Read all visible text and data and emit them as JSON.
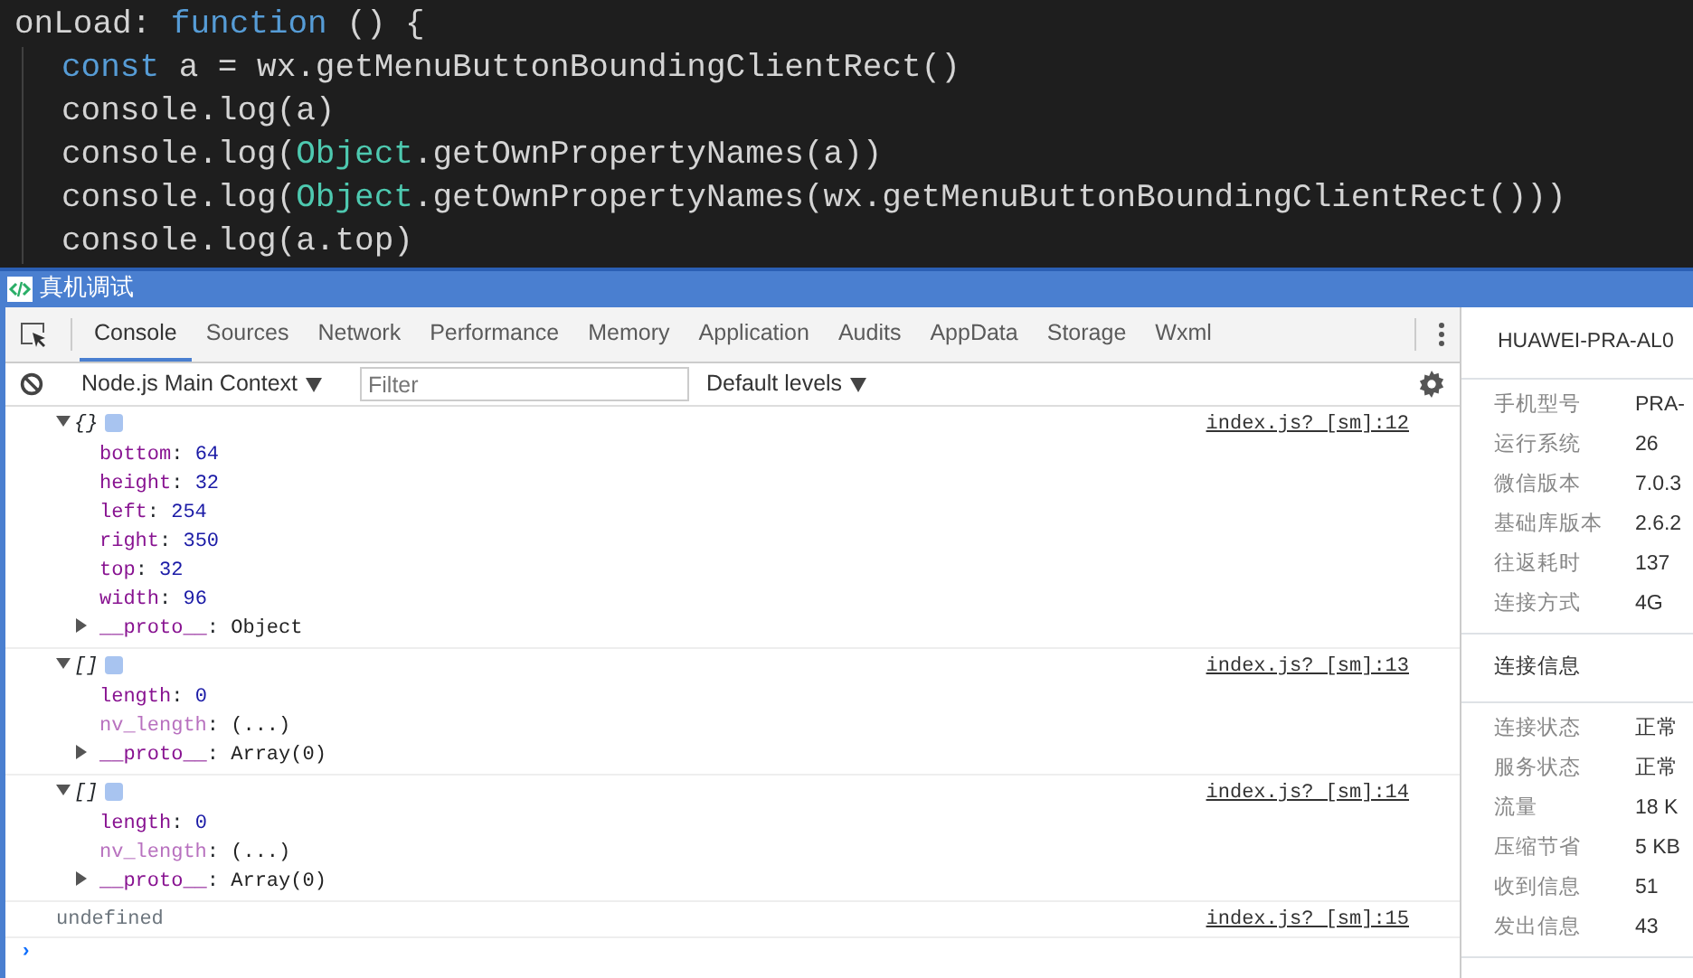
{
  "editor": {
    "lines": [
      {
        "indented": false,
        "tokens": [
          {
            "text": "onLoad: ",
            "kind": "plain"
          },
          {
            "text": "function",
            "kind": "keyword"
          },
          {
            "text": " () {",
            "kind": "plain"
          }
        ]
      },
      {
        "indented": true,
        "tokens": [
          {
            "text": "const",
            "kind": "keyword"
          },
          {
            "text": " a = wx.getMenuButtonBoundingClientRect()",
            "kind": "plain"
          }
        ]
      },
      {
        "indented": true,
        "tokens": [
          {
            "text": "console.log(a)",
            "kind": "plain"
          }
        ]
      },
      {
        "indented": true,
        "tokens": [
          {
            "text": "console.log(",
            "kind": "plain"
          },
          {
            "text": "Object",
            "kind": "builtin"
          },
          {
            "text": ".getOwnPropertyNames(a))",
            "kind": "plain"
          }
        ]
      },
      {
        "indented": true,
        "tokens": [
          {
            "text": "console.log(",
            "kind": "plain"
          },
          {
            "text": "Object",
            "kind": "builtin"
          },
          {
            "text": ".getOwnPropertyNames(wx.getMenuButtonBoundingClientRect()))",
            "kind": "plain"
          }
        ]
      },
      {
        "indented": true,
        "tokens": [
          {
            "text": "console.log(a.top)",
            "kind": "plain"
          }
        ]
      }
    ]
  },
  "window": {
    "title": "真机调试"
  },
  "tabs": [
    {
      "label": "Console",
      "selected": true
    },
    {
      "label": "Sources",
      "selected": false
    },
    {
      "label": "Network",
      "selected": false
    },
    {
      "label": "Performance",
      "selected": false
    },
    {
      "label": "Memory",
      "selected": false
    },
    {
      "label": "Application",
      "selected": false
    },
    {
      "label": "Audits",
      "selected": false
    },
    {
      "label": "AppData",
      "selected": false
    },
    {
      "label": "Storage",
      "selected": false
    },
    {
      "label": "Wxml",
      "selected": false
    }
  ],
  "toolbar": {
    "context": "Node.js Main Context",
    "filter": {
      "placeholder": "Filter"
    },
    "levels": "Default levels"
  },
  "console": {
    "entries": [
      {
        "kind": "tree",
        "summary": "{}",
        "expanded": true,
        "source": "index.js? [sm]:12",
        "properties": [
          {
            "key": "bottom",
            "value": "64",
            "kind": "number"
          },
          {
            "key": "height",
            "value": "32",
            "kind": "number"
          },
          {
            "key": "left",
            "value": "254",
            "kind": "number"
          },
          {
            "key": "right",
            "value": "350",
            "kind": "number"
          },
          {
            "key": "top",
            "value": "32",
            "kind": "number"
          },
          {
            "key": "width",
            "value": "96",
            "kind": "number"
          },
          {
            "key": "__proto__",
            "value": "Object",
            "kind": "proto"
          }
        ]
      },
      {
        "kind": "tree",
        "summary": "[]",
        "expanded": true,
        "source": "index.js? [sm]:13",
        "properties": [
          {
            "key": "length",
            "value": "0",
            "kind": "number"
          },
          {
            "key": "nv_length",
            "value": "(...)",
            "kind": "getter"
          },
          {
            "key": "__proto__",
            "value": "Array(0)",
            "kind": "proto"
          }
        ]
      },
      {
        "kind": "tree",
        "summary": "[]",
        "expanded": true,
        "source": "index.js? [sm]:14",
        "properties": [
          {
            "key": "length",
            "value": "0",
            "kind": "number"
          },
          {
            "key": "nv_length",
            "value": "(...)",
            "kind": "getter"
          },
          {
            "key": "__proto__",
            "value": "Array(0)",
            "kind": "proto"
          }
        ]
      },
      {
        "kind": "value",
        "summary": "undefined",
        "source": "index.js? [sm]:15"
      }
    ],
    "separator": ":",
    "prompt": "›"
  },
  "device_panel": {
    "device": "HUAWEI-PRA-AL0",
    "info": [
      {
        "label": "手机型号",
        "value": "PRA-"
      },
      {
        "label": "运行系统",
        "value": "26"
      },
      {
        "label": "微信版本",
        "value": "7.0.3"
      },
      {
        "label": "基础库版本",
        "value": "2.6.2"
      },
      {
        "label": "往返耗时",
        "value": "137"
      },
      {
        "label": "连接方式",
        "value": "4G"
      }
    ],
    "section": "连接信息",
    "connection": [
      {
        "label": "连接状态",
        "value": "正常"
      },
      {
        "label": "服务状态",
        "value": "正常"
      },
      {
        "label": "流量",
        "value": "18 K"
      },
      {
        "label": "压缩节省",
        "value": "5 KB"
      },
      {
        "label": "收到信息",
        "value": "51"
      },
      {
        "label": "发出信息",
        "value": "43"
      }
    ]
  }
}
